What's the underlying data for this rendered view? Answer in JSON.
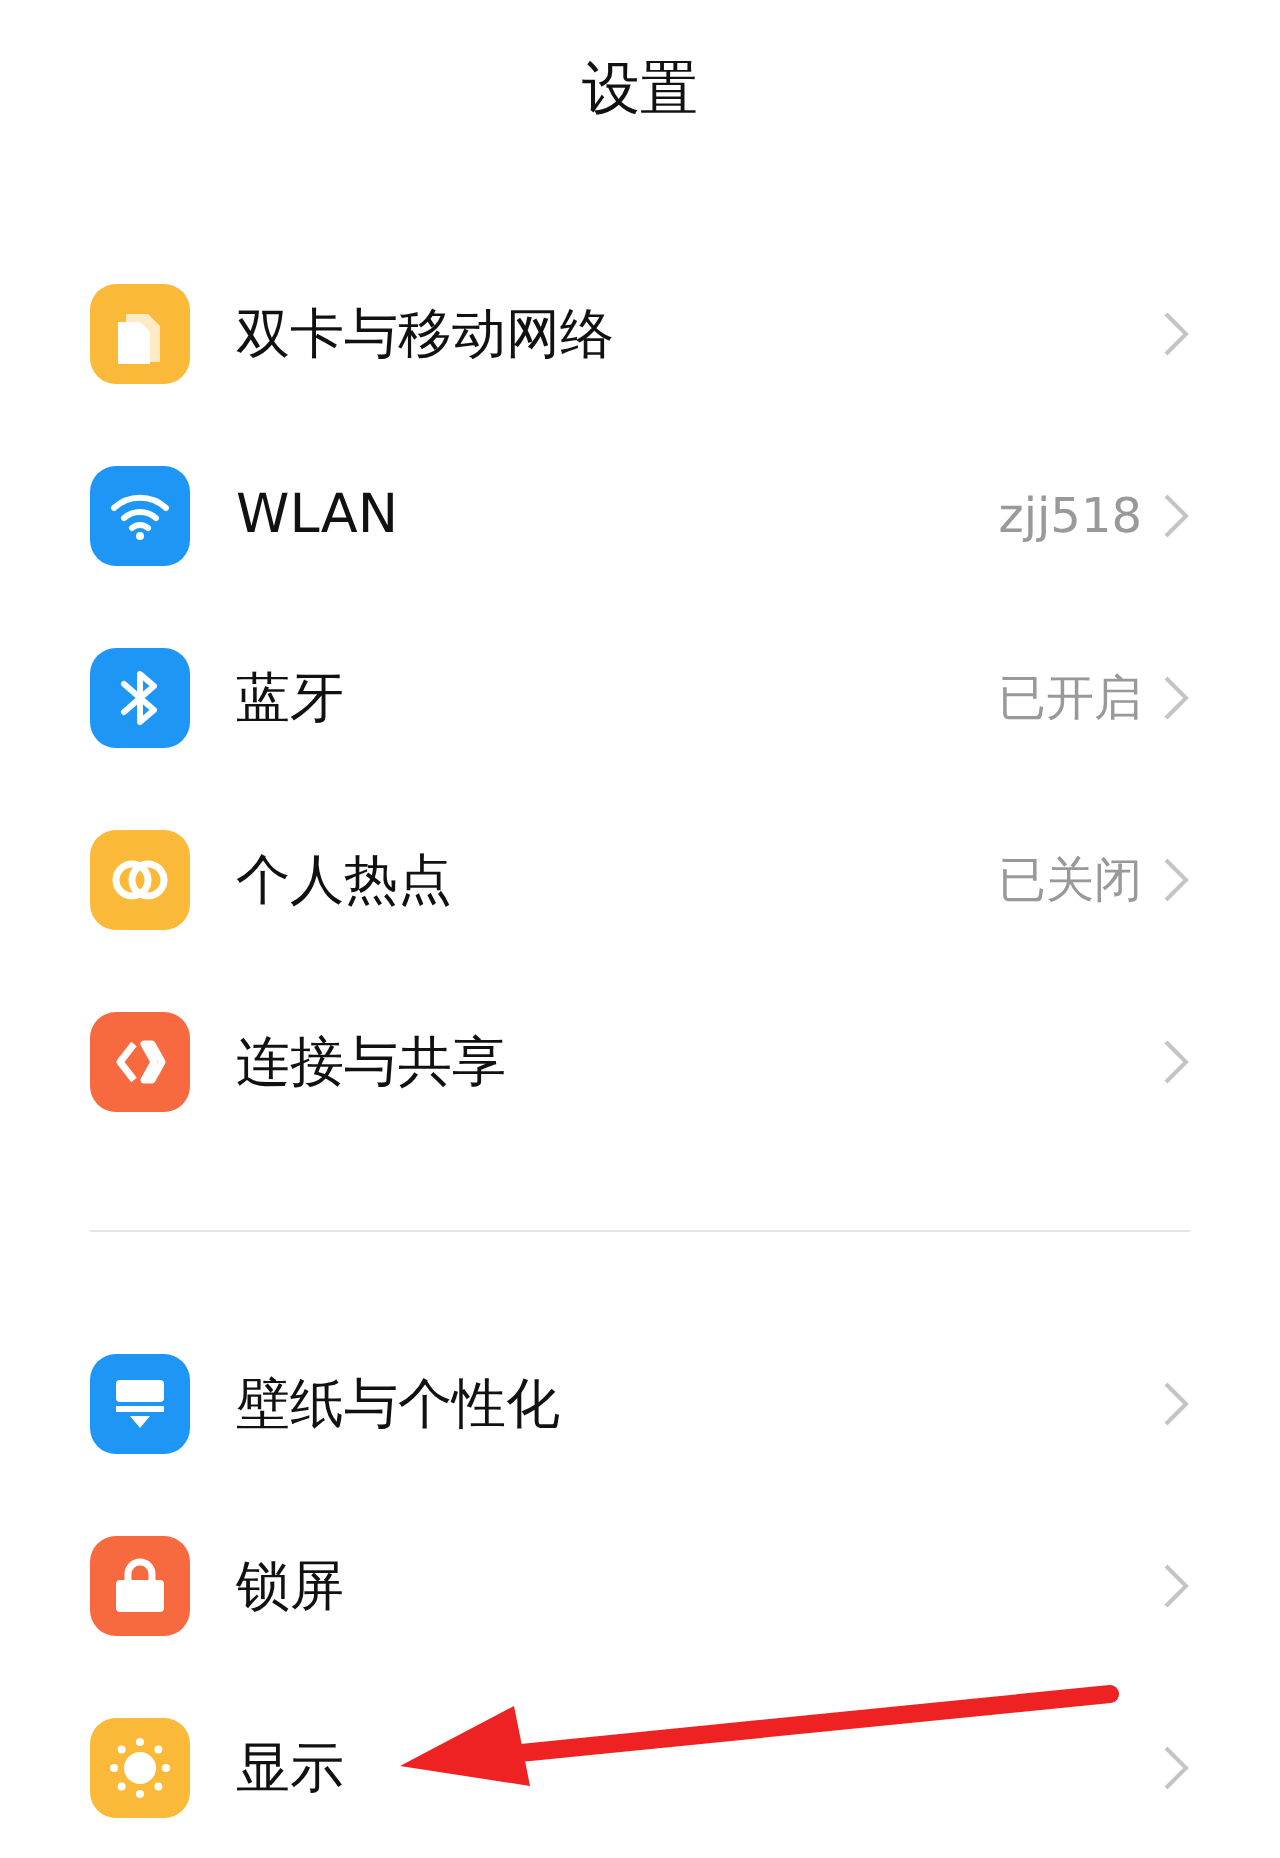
{
  "title": "设置",
  "sections": [
    {
      "items": [
        {
          "kind": "sim",
          "color": "#fbb93a",
          "label": "双卡与移动网络"
        },
        {
          "kind": "wifi",
          "color": "#1e96f5",
          "label": "WLAN",
          "value": "zjj518"
        },
        {
          "kind": "bluetooth",
          "color": "#1e96f5",
          "label": "蓝牙",
          "value": "已开启"
        },
        {
          "kind": "hotspot",
          "color": "#fbb93a",
          "label": "个人热点",
          "value": "已关闭"
        },
        {
          "kind": "share",
          "color": "#f76a3f",
          "label": "连接与共享"
        }
      ]
    },
    {
      "items": [
        {
          "kind": "wallpaper",
          "color": "#1e96f5",
          "label": "壁纸与个性化"
        },
        {
          "kind": "lock",
          "color": "#f76a3f",
          "label": "锁屏"
        },
        {
          "kind": "sun",
          "color": "#fbb93a",
          "label": "显示"
        }
      ]
    }
  ]
}
